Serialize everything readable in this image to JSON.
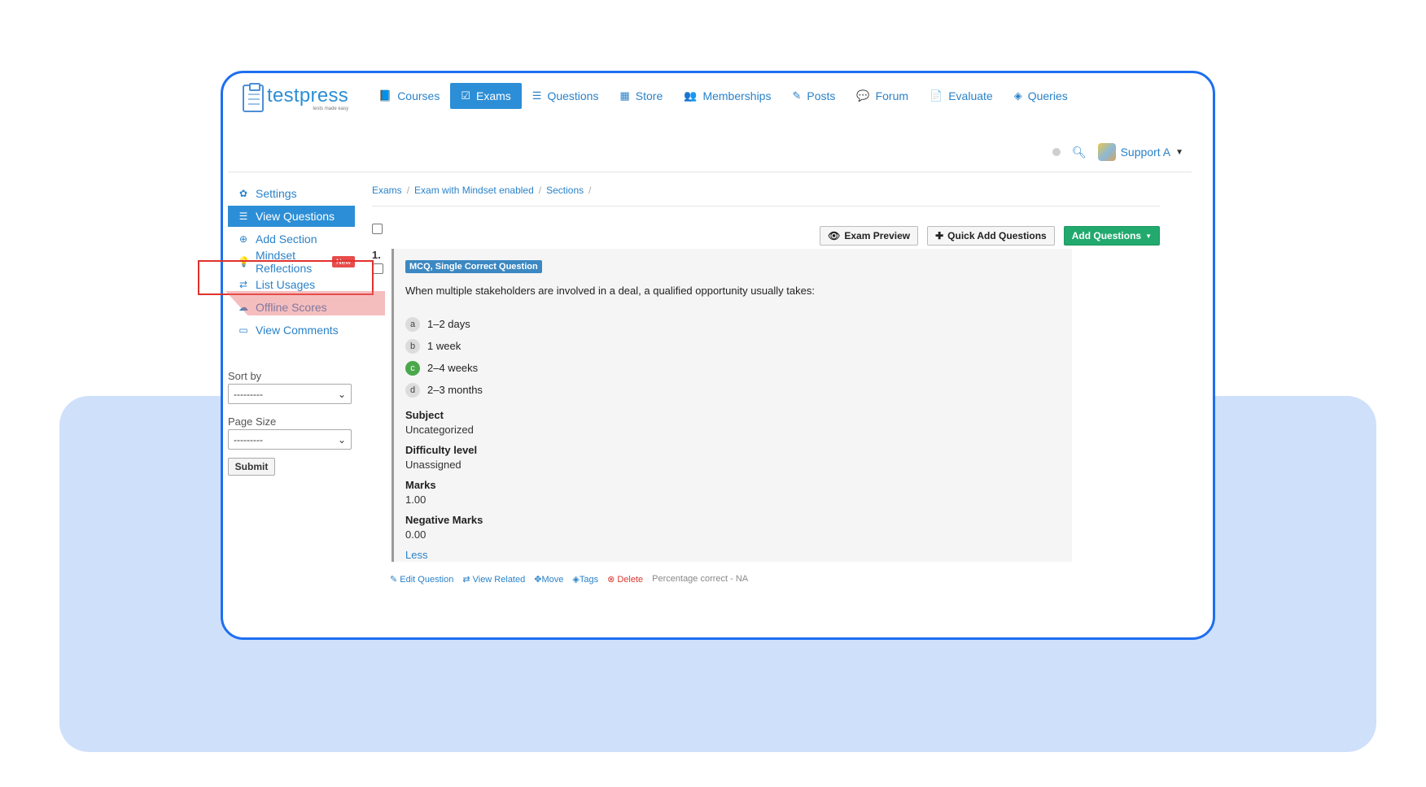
{
  "logo": {
    "title": "testpress",
    "tagline": "tests made easy"
  },
  "nav": [
    {
      "label": "Courses",
      "icon": "book-icon",
      "glyph": "📘",
      "active": false
    },
    {
      "label": "Exams",
      "icon": "exam-icon",
      "glyph": "☑",
      "active": true
    },
    {
      "label": "Questions",
      "icon": "list-icon",
      "glyph": "☰",
      "active": false
    },
    {
      "label": "Store",
      "icon": "store-icon",
      "glyph": "▦",
      "active": false
    },
    {
      "label": "Memberships",
      "icon": "users-icon",
      "glyph": "👥",
      "active": false
    },
    {
      "label": "Posts",
      "icon": "edit-icon",
      "glyph": "✎",
      "active": false
    },
    {
      "label": "Forum",
      "icon": "chat-icon",
      "glyph": "💬",
      "active": false
    },
    {
      "label": "Evaluate",
      "icon": "file-icon",
      "glyph": "📄",
      "active": false
    },
    {
      "label": "Queries",
      "icon": "tag-icon",
      "glyph": "◈",
      "active": false
    }
  ],
  "user": {
    "name": "Support A"
  },
  "sidebar": {
    "items": [
      {
        "label": "Settings",
        "glyph": "✿"
      },
      {
        "label": "View Questions",
        "glyph": "☰"
      },
      {
        "label": "Add Section",
        "glyph": "⊕"
      },
      {
        "label": "Mindset Reflections",
        "glyph": "💡",
        "badge": "New"
      },
      {
        "label": "List Usages",
        "glyph": "⇄"
      },
      {
        "label": "Offline Scores",
        "glyph": "☁"
      },
      {
        "label": "View Comments",
        "glyph": "▭"
      }
    ],
    "sort_label": "Sort by",
    "sort_value": "---------",
    "page_size_label": "Page Size",
    "page_size_value": "---------",
    "submit_label": "Submit"
  },
  "breadcrumb": [
    "Exams",
    "Exam with Mindset enabled",
    "Sections"
  ],
  "toolbar": {
    "preview_label": "Exam Preview",
    "quick_add_label": "Quick Add Questions",
    "add_label": "Add Questions"
  },
  "question": {
    "number": "1.",
    "type": "MCQ, Single Correct Question",
    "text": "When multiple stakeholders are involved in a deal, a qualified opportunity usually takes:",
    "options": [
      {
        "letter": "a",
        "text": "1–2 days",
        "correct": false
      },
      {
        "letter": "b",
        "text": "1 week",
        "correct": false
      },
      {
        "letter": "c",
        "text": "2–4 weeks",
        "correct": true
      },
      {
        "letter": "d",
        "text": "2–3 months",
        "correct": false
      }
    ],
    "subject_label": "Subject",
    "subject": "Uncategorized",
    "difficulty_label": "Difficulty level",
    "difficulty": "Unassigned",
    "marks_label": "Marks",
    "marks": "1.00",
    "negative_label": "Negative Marks",
    "negative": "0.00",
    "less_label": "Less"
  },
  "actions": {
    "edit": "Edit Question",
    "related": "View Related",
    "move": "Move",
    "tags": "Tags",
    "delete": "Delete",
    "percentage": "Percentage correct - NA"
  },
  "colors": {
    "brand": "#2c8ed6",
    "frame": "#1e6ff0",
    "green": "#22a96e",
    "danger": "#d9372f"
  }
}
